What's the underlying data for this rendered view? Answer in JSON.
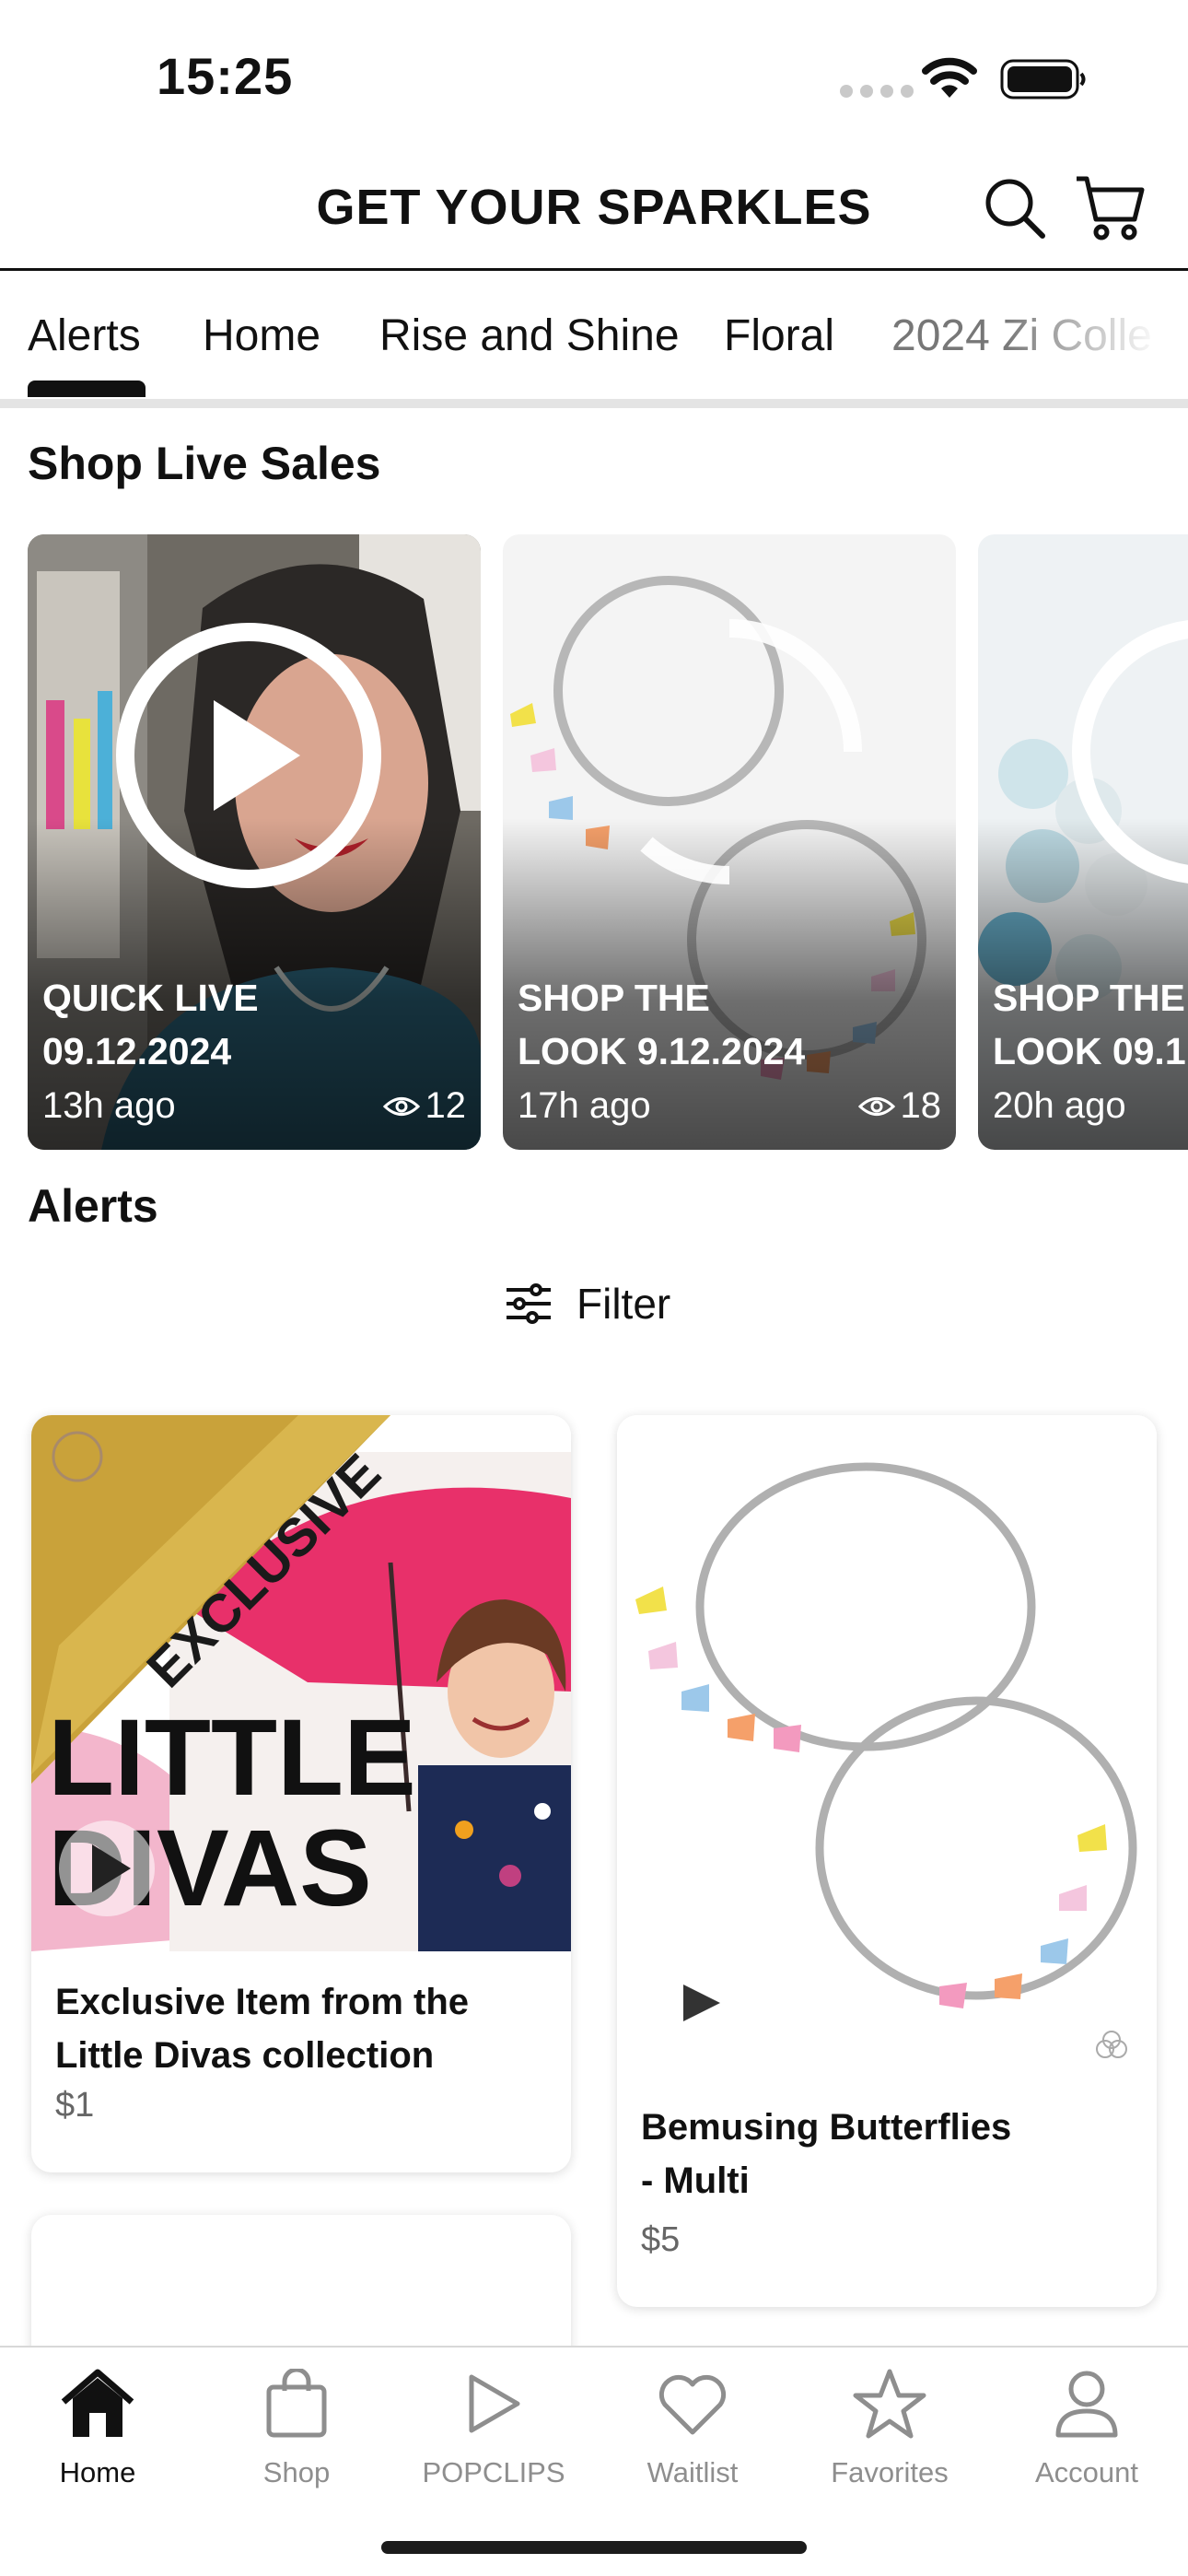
{
  "status_bar": {
    "time": "15:25"
  },
  "header": {
    "title": "GET YOUR SPARKLES"
  },
  "tabs": [
    {
      "label": "Alerts",
      "active": true
    },
    {
      "label": "Home"
    },
    {
      "label": "Rise and Shine"
    },
    {
      "label": "Floral"
    },
    {
      "label": "2024 Zi Colle"
    }
  ],
  "live_section": {
    "title": "Shop Live Sales",
    "cards": [
      {
        "title": "QUICK LIVE\n09.12.2024",
        "time": "13h ago",
        "views": "12"
      },
      {
        "title": "SHOP THE\nLOOK 9.12.2024",
        "time": "17h ago",
        "views": "18"
      },
      {
        "title": "SHOP THE\nLOOK 09.1",
        "time": "20h ago",
        "views": ""
      }
    ]
  },
  "alerts_section": {
    "title": "Alerts",
    "filter_label": "Filter",
    "products": [
      {
        "name": "Exclusive Item from the\nLittle Divas collection",
        "price": "$1",
        "banner_text": "EXCLUSIVE",
        "image_text_1": "LITTLE",
        "image_text_2": "DIVAS"
      },
      {
        "name": "Bemusing Butterflies\n- Multi",
        "price": "$5"
      }
    ]
  },
  "bottom_nav": [
    {
      "label": "Home",
      "icon": "home-icon",
      "active": true
    },
    {
      "label": "Shop",
      "icon": "shopping-bag-icon"
    },
    {
      "label": "POPCLIPS",
      "icon": "play-icon"
    },
    {
      "label": "Waitlist",
      "icon": "heart-icon"
    },
    {
      "label": "Favorites",
      "icon": "star-icon"
    },
    {
      "label": "Account",
      "icon": "account-icon"
    }
  ],
  "colors": {
    "text": "#111111",
    "inactive": "#8e8e8e",
    "divider": "#e4e4e4",
    "gold": "#c9a23a",
    "pink": "#e8306a"
  }
}
